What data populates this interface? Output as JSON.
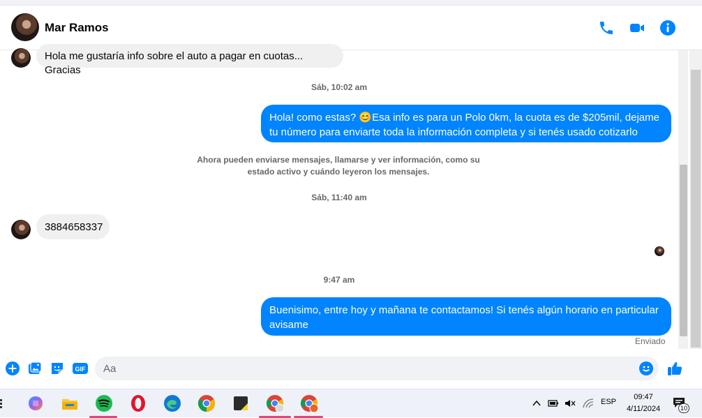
{
  "header": {
    "contact_name": "Mar Ramos"
  },
  "messages": {
    "m1": "Hola me gustaría info sobre el auto a pagar en cuotas... Gracias",
    "ts1": "Sáb, 10:02 am",
    "m2": "Hola! como estas? 😊Esa info es para un Polo 0km, la cuota es de $205mil, dejame tu número para enviarte toda la información completa y si tenés usado cotizarlo",
    "system_note": "Ahora pueden enviarse mensajes, llamarse y ver información, como su estado activo y cuándo leyeron los mensajes.",
    "ts2": "Sáb, 11:40 am",
    "m3": "3884658337",
    "ts3": "9:47 am",
    "m4": "Buenisimo, entre hoy y mañana te contactamos! Si tenés algún horario en particular avisame",
    "sent_status": "Enviado"
  },
  "composer": {
    "placeholder": "Aa"
  },
  "taskbar": {
    "language": "ESP",
    "time": "09:47",
    "date": "4/11/2024",
    "notification_count": "10"
  },
  "colors": {
    "accent": "#0084ff",
    "incoming_bubble": "#f0f0f0",
    "meta_text": "#65676b"
  }
}
